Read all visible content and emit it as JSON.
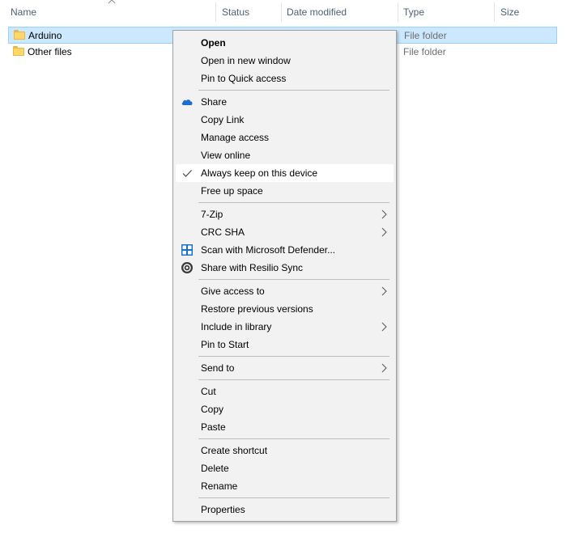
{
  "headers": {
    "name": "Name",
    "status": "Status",
    "date_modified": "Date modified",
    "type": "Type",
    "size": "Size",
    "sort_icon": "sort-ascending-arrow"
  },
  "files": [
    {
      "name": "Arduino",
      "type": "File folder",
      "selected": true
    },
    {
      "name": "Other files",
      "type": "File folder",
      "selected": false
    }
  ],
  "menu": {
    "open": "Open",
    "open_new_window": "Open in new window",
    "pin_quick_access": "Pin to Quick access",
    "share": "Share",
    "copy_link": "Copy Link",
    "manage_access": "Manage access",
    "view_online": "View online",
    "always_keep": "Always keep on this device",
    "free_up_space": "Free up space",
    "seven_zip": "7-Zip",
    "crc_sha": "CRC SHA",
    "scan_defender": "Scan with Microsoft Defender...",
    "share_resilio": "Share with Resilio Sync",
    "give_access": "Give access to",
    "restore_versions": "Restore previous versions",
    "include_library": "Include in library",
    "pin_start": "Pin to Start",
    "send_to": "Send to",
    "cut": "Cut",
    "copy": "Copy",
    "paste": "Paste",
    "create_shortcut": "Create shortcut",
    "delete": "Delete",
    "rename": "Rename",
    "properties": "Properties"
  },
  "colors": {
    "header_text": "#4c607a",
    "selection": "#cce8ff",
    "menu_bg": "#f2f2f2",
    "onedrive": "#1e6ed6",
    "defender": "#1b72c9"
  }
}
